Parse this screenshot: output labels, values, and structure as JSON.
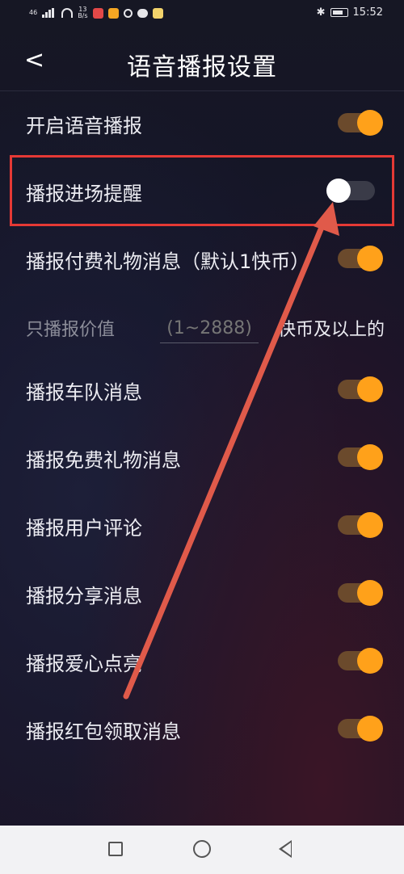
{
  "status_bar": {
    "signal_small": "46",
    "net_speed_top": "13",
    "net_speed_bottom": "B/s",
    "time": "15:52"
  },
  "header": {
    "back_symbol": "<",
    "title": "语音播报设置"
  },
  "settings": [
    {
      "label": "开启语音播报",
      "on": true
    },
    {
      "label": "播报进场提醒",
      "on": false
    },
    {
      "label": "播报付费礼物消息（默认1快币）",
      "on": true
    }
  ],
  "value_filter": {
    "prefix": "只播报价值",
    "placeholder": "(1~2888)",
    "suffix": "快币及以上的"
  },
  "settings_more": [
    {
      "label": "播报车队消息",
      "on": true
    },
    {
      "label": "播报免费礼物消息",
      "on": true
    },
    {
      "label": "播报用户评论",
      "on": true
    },
    {
      "label": "播报分享消息",
      "on": true
    },
    {
      "label": "播报爱心点亮",
      "on": true
    },
    {
      "label": "播报红包领取消息",
      "on": true
    }
  ],
  "colors": {
    "accent": "#ffa11a",
    "highlight": "#e53935"
  },
  "icons": {
    "back": "chevron-left-icon",
    "nav_square": "recent-apps-icon",
    "nav_circle": "home-icon",
    "nav_triangle": "back-triangle-icon"
  }
}
